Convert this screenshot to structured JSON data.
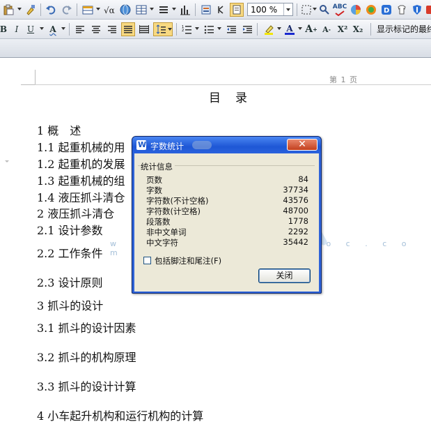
{
  "toolbar": {
    "zoom": "100 %",
    "show_marks": "显示标记的最终",
    "bold": "B",
    "italic": "I",
    "underline": "U",
    "font_color_letter": "A",
    "grow_font": "A",
    "shrink_font": "A",
    "superscript": "X²",
    "subscript": "X₂",
    "spellcheck": "ABC"
  },
  "document": {
    "page_number": "第 1 页",
    "title": "目　录",
    "toc": [
      "1  概　述",
      "1.1 起重机械的用",
      "1.2 起重机的发展",
      "1.3 起重机械的组",
      "1.4 液压抓斗清仓",
      "2  液压抓斗清仓",
      "2.1 设计参数",
      "2.2 工作条件",
      "2.3 设计原则",
      "3  抓斗的设计",
      "3.1 抓斗的设计因素",
      "3.2 抓斗的机构原理",
      "3.3 抓斗的设计计算",
      "4  小车起升机构和运行机构的计算"
    ]
  },
  "watermark": {
    "url": "w w w . r e n r e n d o c . c o m"
  },
  "dialog": {
    "title": "字数统计",
    "close_glyph": "✕",
    "group_label": "统计信息",
    "stats": [
      {
        "label": "页数",
        "value": "84"
      },
      {
        "label": "字数",
        "value": "37734"
      },
      {
        "label": "字符数(不计空格)",
        "value": "43576"
      },
      {
        "label": "字符数(计空格)",
        "value": "48700"
      },
      {
        "label": "段落数",
        "value": "1778"
      },
      {
        "label": "非中文单词",
        "value": "2292"
      },
      {
        "label": "中文字符",
        "value": "35442"
      }
    ],
    "checkbox_label": "包括脚注和尾注(F)",
    "close_button": "关闭"
  },
  "colors": {
    "dialog_title_blue": "#2a62dd",
    "close_red": "#c2401e",
    "dialog_body": "#ece9d8",
    "watermark_blue": "#7fb0dd"
  }
}
